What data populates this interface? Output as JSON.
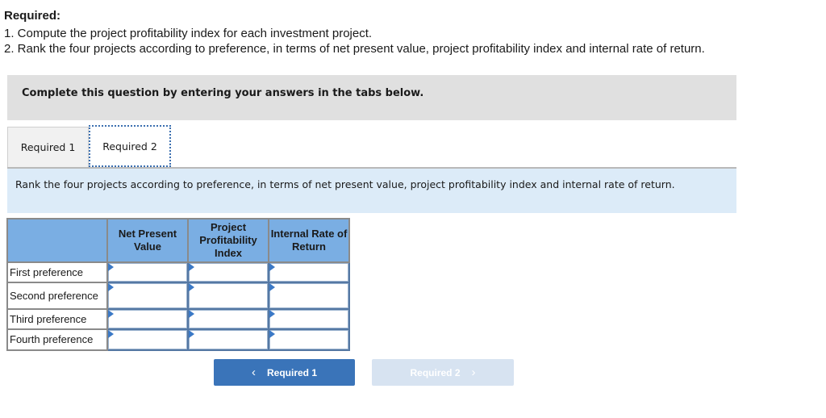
{
  "required": {
    "title": "Required:",
    "lines": [
      "1. Compute the project profitability index for each investment project.",
      "2. Rank the four projects according to preference, in terms of net present value, project profitability index and internal rate of return."
    ]
  },
  "banner": "Complete this question by entering your answers in the tabs below.",
  "tabs": [
    {
      "label": "Required 1",
      "active": false
    },
    {
      "label": "Required 2",
      "active": true
    }
  ],
  "instruction": "Rank the four projects according to preference, in terms of net present value, project profitability index and internal rate of return.",
  "table": {
    "columns": [
      "",
      "Net Present Value",
      "Project Profitability Index",
      "Internal Rate of Return"
    ],
    "rows": [
      {
        "label": "First preference",
        "values": [
          "",
          "",
          ""
        ]
      },
      {
        "label": "Second preference",
        "values": [
          "",
          "",
          ""
        ]
      },
      {
        "label": "Third preference",
        "values": [
          "",
          "",
          ""
        ]
      },
      {
        "label": "Fourth preference",
        "values": [
          "",
          "",
          ""
        ]
      }
    ]
  },
  "nav": {
    "prev_label": "Required 1",
    "prev_icon": "chevron-left-icon",
    "next_label": "Required 2",
    "next_icon": "chevron-right-icon",
    "next_disabled": true
  },
  "colors": {
    "header_blue": "#7aaee3",
    "button_blue": "#3a74b9",
    "button_disabled": "#d7e3f1",
    "instruction_bg": "#dcebf8",
    "banner_bg": "#e0e0e0"
  }
}
